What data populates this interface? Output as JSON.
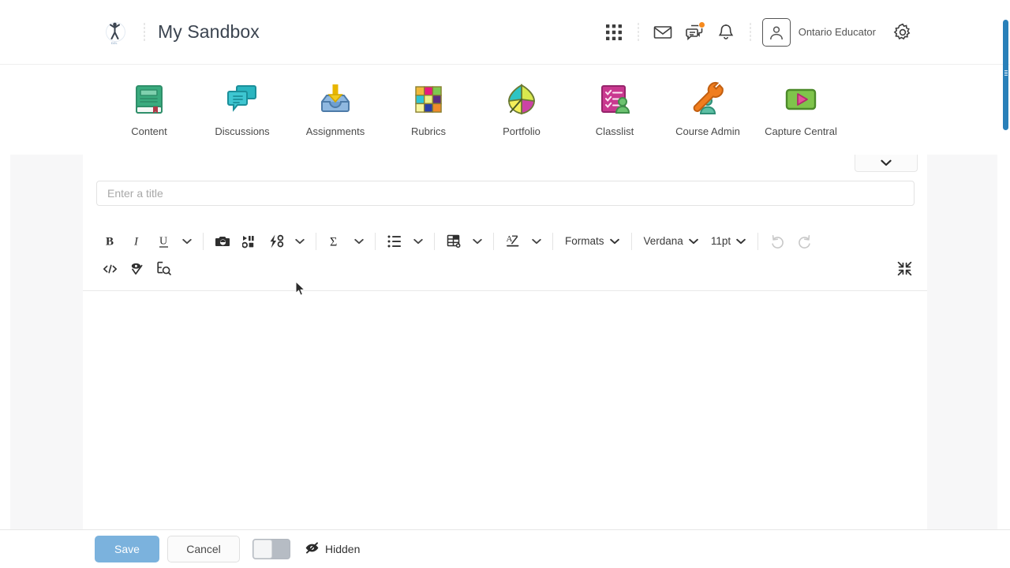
{
  "header": {
    "logo_name": "brightspace-logo",
    "logo_caption": "D2L",
    "app_title": "My Sandbox",
    "icons": {
      "waffle": "app-grid-icon",
      "email": "email-icon",
      "messages": "messages-icon",
      "notifications": "bell-icon",
      "settings": "gear-icon"
    },
    "user_name": "Ontario Educator"
  },
  "nav": {
    "items": [
      {
        "label": "Content",
        "icon": "content-book-icon"
      },
      {
        "label": "Discussions",
        "icon": "discussions-chat-icon"
      },
      {
        "label": "Assignments",
        "icon": "assignments-inbox-icon"
      },
      {
        "label": "Rubrics",
        "icon": "rubrics-grid-icon"
      },
      {
        "label": "Portfolio",
        "icon": "portfolio-leaf-icon"
      },
      {
        "label": "Classlist",
        "icon": "classlist-checklist-icon"
      },
      {
        "label": "Course Admin",
        "icon": "course-admin-wrench-icon"
      },
      {
        "label": "Capture Central",
        "icon": "capture-central-play-icon"
      }
    ]
  },
  "editor": {
    "collapse_panel_icon": "chevron-down-icon",
    "title_placeholder": "Enter a title",
    "title_value": "",
    "toolbar_row1": [
      {
        "name": "bold-button",
        "glyph": "B",
        "type": "glyph"
      },
      {
        "name": "italic-button",
        "glyph": "I",
        "type": "glyph"
      },
      {
        "name": "underline-button",
        "glyph": "U",
        "type": "glyph"
      },
      {
        "name": "text-style-more-caret",
        "type": "caret"
      },
      {
        "name": "insert-image-button",
        "type": "icon"
      },
      {
        "name": "insert-media-button",
        "type": "icon"
      },
      {
        "name": "insert-quicklink-button",
        "type": "icon"
      },
      {
        "name": "insert-more-caret",
        "type": "caret"
      },
      {
        "name": "equation-button",
        "glyph": "Σ",
        "type": "glyph"
      },
      {
        "name": "equation-more-caret",
        "type": "caret"
      },
      {
        "name": "list-button",
        "type": "icon"
      },
      {
        "name": "list-more-caret",
        "type": "caret"
      },
      {
        "name": "table-button",
        "type": "icon"
      },
      {
        "name": "table-more-caret",
        "type": "caret"
      },
      {
        "name": "text-color-button",
        "type": "icon"
      },
      {
        "name": "text-color-caret",
        "type": "caret"
      }
    ],
    "formats_label": "Formats",
    "font_family_value": "Verdana",
    "font_size_value": "11pt",
    "undo_label": "undo-icon",
    "redo_label": "redo-icon",
    "toolbar_row2": [
      {
        "name": "html-source-button",
        "icon": "code-brackets-icon"
      },
      {
        "name": "spellcheck-button",
        "icon": "spellcheck-icon"
      },
      {
        "name": "accessibility-check-button",
        "icon": "accessibility-check-icon"
      }
    ],
    "collapse_editor_icon": "collapse-inward-icon"
  },
  "footer": {
    "save_label": "Save",
    "cancel_label": "Cancel",
    "visibility_toggle_state": "off",
    "visibility_label": "Hidden",
    "visibility_icon": "eye-hidden-icon"
  },
  "colors": {
    "accent_blue": "#2980b9",
    "save_blue": "#7bb2dd",
    "badge_orange": "#f68a1e",
    "content_green": "#3aab7e",
    "discussions_teal": "#2ab5c0",
    "assignments_blue": "#8fb8e0",
    "portfolio_magenta": "#cc43a5",
    "classlist_pink": "#c9388f",
    "course_admin_orange": "#f07d1e",
    "capture_green": "#7fc44b"
  }
}
